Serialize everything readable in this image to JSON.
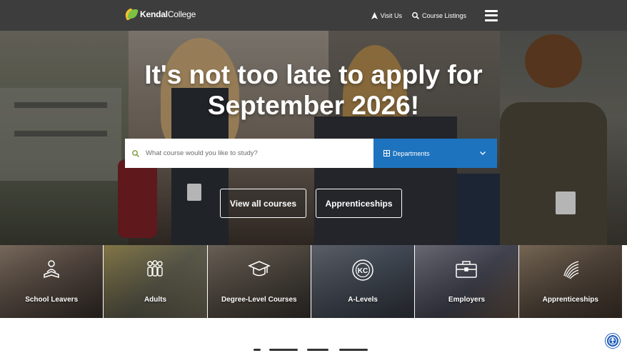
{
  "header": {
    "brand_bold": "Kendal",
    "brand_light": "College",
    "nav": [
      {
        "label": "Visit Us",
        "icon": "location-arrow-icon"
      },
      {
        "label": "Course Listings",
        "icon": "search-icon"
      }
    ],
    "menu_icon": "hamburger-menu-icon"
  },
  "hero": {
    "title_line1": "It's not too late to apply for",
    "title_line2": "September 2026!",
    "search": {
      "placeholder": "What course would you like to study?",
      "value": ""
    },
    "departments_label": "Departments",
    "buttons": [
      {
        "label": "View all courses"
      },
      {
        "label": "Apprenticeships"
      }
    ]
  },
  "tiles": [
    {
      "label": "School Leavers",
      "icon": "reading-student-icon"
    },
    {
      "label": "Adults",
      "icon": "people-group-icon"
    },
    {
      "label": "Degree-Level Courses",
      "icon": "graduation-cap-icon"
    },
    {
      "label": "A-Levels",
      "icon": "kc-sixth-badge-icon",
      "badge_text": "KC"
    },
    {
      "label": "Employers",
      "icon": "briefcase-icon"
    },
    {
      "label": "Apprenticeships",
      "icon": "swirl-icon"
    }
  ],
  "colors": {
    "header_bg": "#3d3d3d",
    "accent_blue": "#1e73be",
    "accessibility_blue": "#1e5bb8"
  },
  "accessibility_button_icon": "accessibility-icon"
}
